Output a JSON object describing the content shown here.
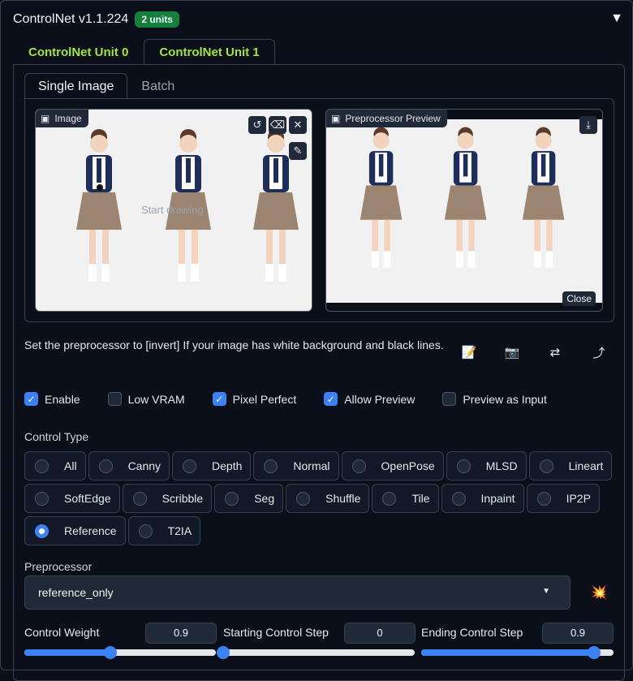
{
  "header": {
    "title": "ControlNet v1.1.224",
    "badge": "2 units",
    "collapse_icon": "triangle-down"
  },
  "unit_tabs": [
    {
      "label": "ControlNet Unit 0"
    },
    {
      "label": "ControlNet Unit 1"
    }
  ],
  "image_tabs": [
    {
      "label": "Single Image"
    },
    {
      "label": "Batch"
    }
  ],
  "image_panel": {
    "label": "Image",
    "hint": "Start drawing"
  },
  "preview_panel": {
    "label": "Preprocessor Preview",
    "close_label": "Close"
  },
  "hint_text": "Set the preprocessor to [invert] If your image has white background and black lines.",
  "checkboxes": [
    {
      "label": "Enable",
      "checked": true
    },
    {
      "label": "Low VRAM",
      "checked": false
    },
    {
      "label": "Pixel Perfect",
      "checked": true
    },
    {
      "label": "Allow Preview",
      "checked": true
    },
    {
      "label": "Preview as Input",
      "checked": false
    }
  ],
  "control_type": {
    "label": "Control Type",
    "options": [
      "All",
      "Canny",
      "Depth",
      "Normal",
      "OpenPose",
      "MLSD",
      "Lineart",
      "SoftEdge",
      "Scribble",
      "Seg",
      "Shuffle",
      "Tile",
      "Inpaint",
      "IP2P",
      "Reference",
      "T2IA"
    ],
    "selected": "Reference"
  },
  "preprocessor": {
    "label": "Preprocessor",
    "value": "reference_only"
  },
  "sliders": [
    {
      "label": "Control Weight",
      "value": "0.9",
      "fraction": 0.45
    },
    {
      "label": "Starting Control Step",
      "value": "0",
      "fraction": 0.0
    },
    {
      "label": "Ending Control Step",
      "value": "0.9",
      "fraction": 0.9
    }
  ],
  "colors": {
    "accent": "#3b82f6",
    "tab_green": "#a3e635",
    "badge_green": "#15803d"
  }
}
